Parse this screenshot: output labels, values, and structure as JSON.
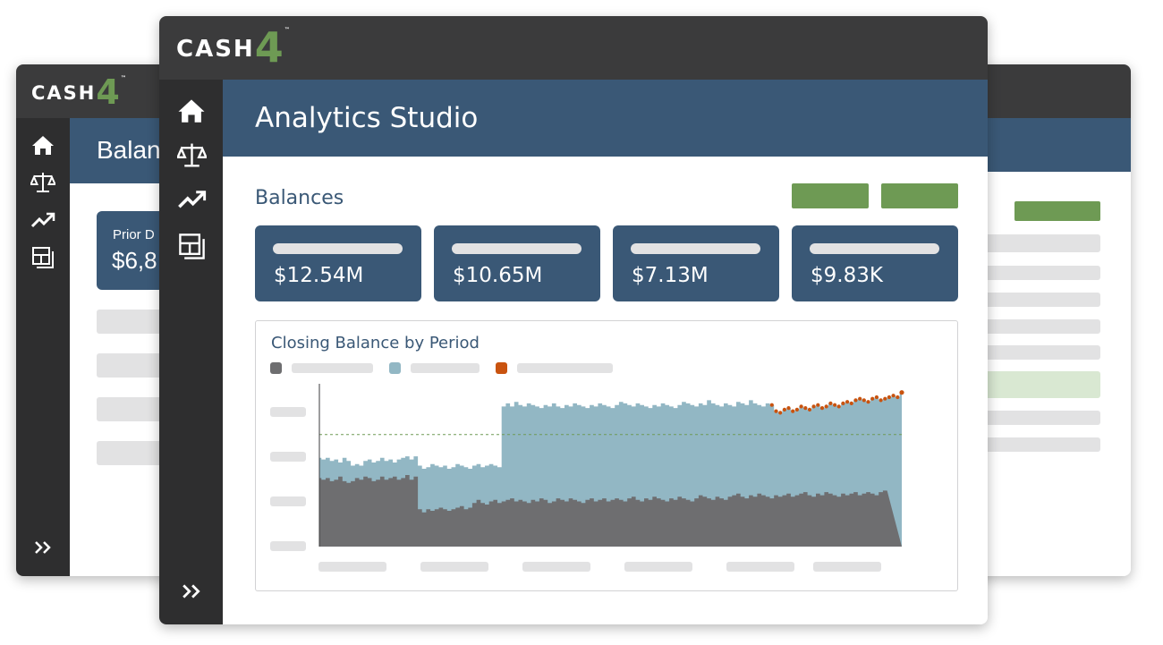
{
  "brand": {
    "word": "CASH",
    "digit": "4",
    "tm": "™"
  },
  "colors": {
    "titlebar": "#3b3b3c",
    "sidebar": "#2e2e2f",
    "header": "#3a5876",
    "accent_green": "#6e9a54",
    "placeholder": "#e2e2e3"
  },
  "sidebar": {
    "items": [
      {
        "icon": "home-icon"
      },
      {
        "icon": "balance-scale-icon"
      },
      {
        "icon": "trending-up-icon"
      },
      {
        "icon": "layout-grid-icon"
      }
    ],
    "expand_icon": "double-chevron-right-icon"
  },
  "back_left_window": {
    "header_title": "Balan",
    "card": {
      "label": "Prior D",
      "value": "$6,8"
    }
  },
  "main_window": {
    "header_title": "Analytics Studio",
    "section_title": "Balances",
    "kpis": [
      {
        "value": "$12.54M"
      },
      {
        "value": "$10.65M"
      },
      {
        "value": "$7.13M"
      },
      {
        "value": "$9.83K"
      }
    ],
    "chart": {
      "title": "Closing Balance by Period"
    }
  },
  "chart_data": {
    "type": "area",
    "title": "Closing Balance by Period",
    "series_colors": {
      "base": "#6e6e70",
      "stack": "#92b7c4",
      "highlight": "#c9530f",
      "reference_line": "#6e9a54"
    },
    "legend_colors": [
      "#6e6e70",
      "#92b7c4",
      "#c9530f"
    ],
    "ylim": [
      0,
      100
    ],
    "reference_line": 72,
    "base": [
      44,
      43,
      44,
      42,
      43,
      45,
      42,
      41,
      42,
      44,
      43,
      45,
      44,
      42,
      43,
      45,
      43,
      44,
      45,
      43,
      44,
      46,
      43,
      45,
      24,
      22,
      24,
      23,
      24,
      25,
      24,
      23,
      24,
      25,
      26,
      24,
      25,
      28,
      30,
      28,
      27,
      29,
      30,
      28,
      29,
      30,
      31,
      29,
      30,
      29,
      28,
      30,
      29,
      31,
      30,
      28,
      29,
      31,
      30,
      29,
      31,
      30,
      29,
      28,
      30,
      31,
      29,
      30,
      31,
      29,
      30,
      31,
      30,
      29,
      31,
      32,
      30,
      29,
      31,
      30,
      32,
      31,
      30,
      29,
      31,
      30,
      32,
      31,
      30,
      29,
      31,
      33,
      32,
      31,
      30,
      32,
      31,
      30,
      32,
      33,
      34,
      32,
      31,
      33,
      32,
      34,
      33,
      32,
      31,
      33,
      32,
      33,
      34,
      32,
      33,
      34,
      35,
      33,
      32,
      34,
      33,
      35,
      34,
      33,
      32,
      34,
      33,
      34,
      35,
      33,
      34,
      35,
      34,
      33,
      35,
      36
    ],
    "total": [
      57,
      56,
      57,
      55,
      56,
      54,
      57,
      55,
      52,
      53,
      52,
      55,
      56,
      54,
      55,
      57,
      55,
      56,
      54,
      56,
      57,
      58,
      56,
      58,
      52,
      50,
      51,
      53,
      52,
      51,
      52,
      50,
      51,
      53,
      52,
      51,
      50,
      52,
      53,
      51,
      52,
      53,
      52,
      51,
      90,
      92,
      90,
      93,
      91,
      90,
      92,
      91,
      90,
      89,
      91,
      90,
      92,
      90,
      89,
      91,
      90,
      92,
      91,
      90,
      89,
      91,
      90,
      92,
      91,
      90,
      89,
      91,
      93,
      92,
      91,
      90,
      92,
      91,
      90,
      89,
      91,
      90,
      92,
      91,
      90,
      89,
      91,
      93,
      92,
      91,
      90,
      92,
      91,
      94,
      92,
      91,
      90,
      92,
      91,
      90,
      93,
      92,
      91,
      94,
      92,
      91,
      90,
      92,
      91,
      87,
      86,
      88,
      89,
      87,
      88,
      90,
      89,
      88,
      90,
      91,
      89,
      90,
      92,
      91,
      90,
      92,
      93,
      92,
      94,
      95,
      94,
      93,
      95,
      96,
      94,
      95,
      96,
      97,
      96,
      99
    ],
    "highlight_start_index": 108
  }
}
